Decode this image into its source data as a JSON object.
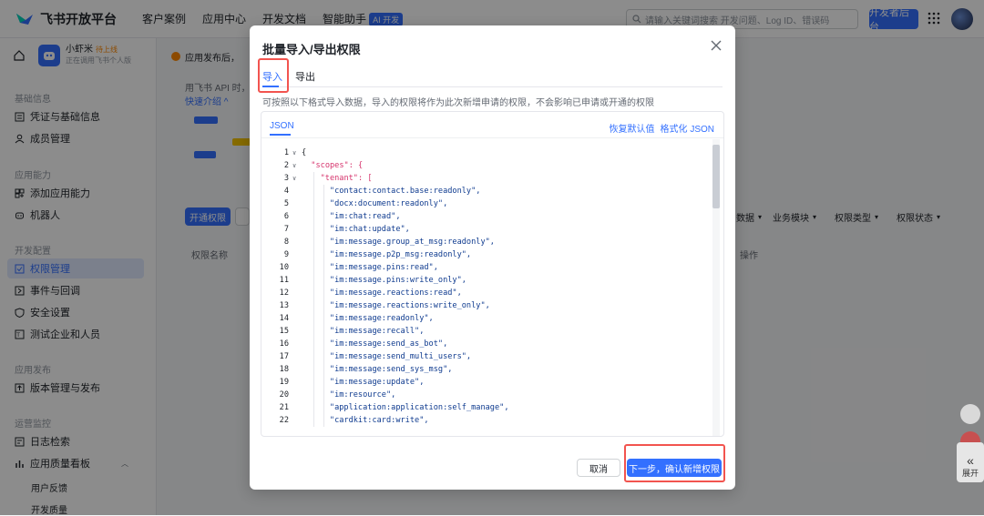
{
  "topbar": {
    "brand": "飞书开放平台",
    "nav": [
      "客户案例",
      "应用中心",
      "开发文档",
      "智能助手"
    ],
    "ai_badge": "AI 开发",
    "search_placeholder": "请输入关键词搜索 开发问题、Log ID、错误码",
    "dev_console": "开发者后台"
  },
  "sidebar": {
    "app_name": "小虾米",
    "app_tag": "待上线",
    "app_sub": "正在调用飞书个人版",
    "sections": [
      "基础信息",
      "应用能力",
      "开发配置",
      "应用发布",
      "运营监控"
    ],
    "items": [
      "凭证与基础信息",
      "成员管理",
      "添加应用能力",
      "机器人",
      "权限管理",
      "事件与回调",
      "安全设置",
      "测试企业和人员",
      "版本管理与发布",
      "日志检索",
      "应用质量看板"
    ],
    "sub_items": [
      "用户反馈",
      "开发质量"
    ]
  },
  "background": {
    "notice": "应用发布后，",
    "api_hint": "用飞书 API 时，",
    "learn_more": "快速介绍 ^",
    "open_perm": "开通权限",
    "filters": [
      "数据",
      "业务模块",
      "权限类型",
      "权限状态"
    ],
    "col_perm_name": "权限名称",
    "col_action": "操作"
  },
  "modal": {
    "title": "批量导入/导出权限",
    "tab_import": "导入",
    "tab_export": "导出",
    "description": "可按照以下格式导入数据，导入的权限将作为此次新增申请的权限，不会影响已申请或开通的权限",
    "editor_tab": "JSON",
    "restore_default": "恢复默认值",
    "format_json": "格式化 JSON",
    "cancel": "取消",
    "next": "下一步，确认新增权限"
  },
  "code_lines": [
    {
      "n": "1",
      "fold": true,
      "indent": 0,
      "text": "{"
    },
    {
      "n": "2",
      "fold": true,
      "indent": 1,
      "text": "\"scopes\": {"
    },
    {
      "n": "3",
      "fold": true,
      "indent": 2,
      "text": "\"tenant\": ["
    },
    {
      "n": "4",
      "fold": false,
      "indent": 3,
      "text": "\"contact:contact.base:readonly\","
    },
    {
      "n": "5",
      "fold": false,
      "indent": 3,
      "text": "\"docx:document:readonly\","
    },
    {
      "n": "6",
      "fold": false,
      "indent": 3,
      "text": "\"im:chat:read\","
    },
    {
      "n": "7",
      "fold": false,
      "indent": 3,
      "text": "\"im:chat:update\","
    },
    {
      "n": "8",
      "fold": false,
      "indent": 3,
      "text": "\"im:message.group_at_msg:readonly\","
    },
    {
      "n": "9",
      "fold": false,
      "indent": 3,
      "text": "\"im:message.p2p_msg:readonly\","
    },
    {
      "n": "10",
      "fold": false,
      "indent": 3,
      "text": "\"im:message.pins:read\","
    },
    {
      "n": "11",
      "fold": false,
      "indent": 3,
      "text": "\"im:message.pins:write_only\","
    },
    {
      "n": "12",
      "fold": false,
      "indent": 3,
      "text": "\"im:message.reactions:read\","
    },
    {
      "n": "13",
      "fold": false,
      "indent": 3,
      "text": "\"im:message.reactions:write_only\","
    },
    {
      "n": "14",
      "fold": false,
      "indent": 3,
      "text": "\"im:message:readonly\","
    },
    {
      "n": "15",
      "fold": false,
      "indent": 3,
      "text": "\"im:message:recall\","
    },
    {
      "n": "16",
      "fold": false,
      "indent": 3,
      "text": "\"im:message:send_as_bot\","
    },
    {
      "n": "17",
      "fold": false,
      "indent": 3,
      "text": "\"im:message:send_multi_users\","
    },
    {
      "n": "18",
      "fold": false,
      "indent": 3,
      "text": "\"im:message:send_sys_msg\","
    },
    {
      "n": "19",
      "fold": false,
      "indent": 3,
      "text": "\"im:message:update\","
    },
    {
      "n": "20",
      "fold": false,
      "indent": 3,
      "text": "\"im:resource\","
    },
    {
      "n": "21",
      "fold": false,
      "indent": 3,
      "text": "\"application:application:self_manage\","
    },
    {
      "n": "22",
      "fold": false,
      "indent": 3,
      "text": "\"cardkit:card:write\","
    }
  ],
  "float": {
    "expand": "展开"
  },
  "colors": {
    "accent": "#3370ff",
    "highlight": "#f2544f"
  }
}
